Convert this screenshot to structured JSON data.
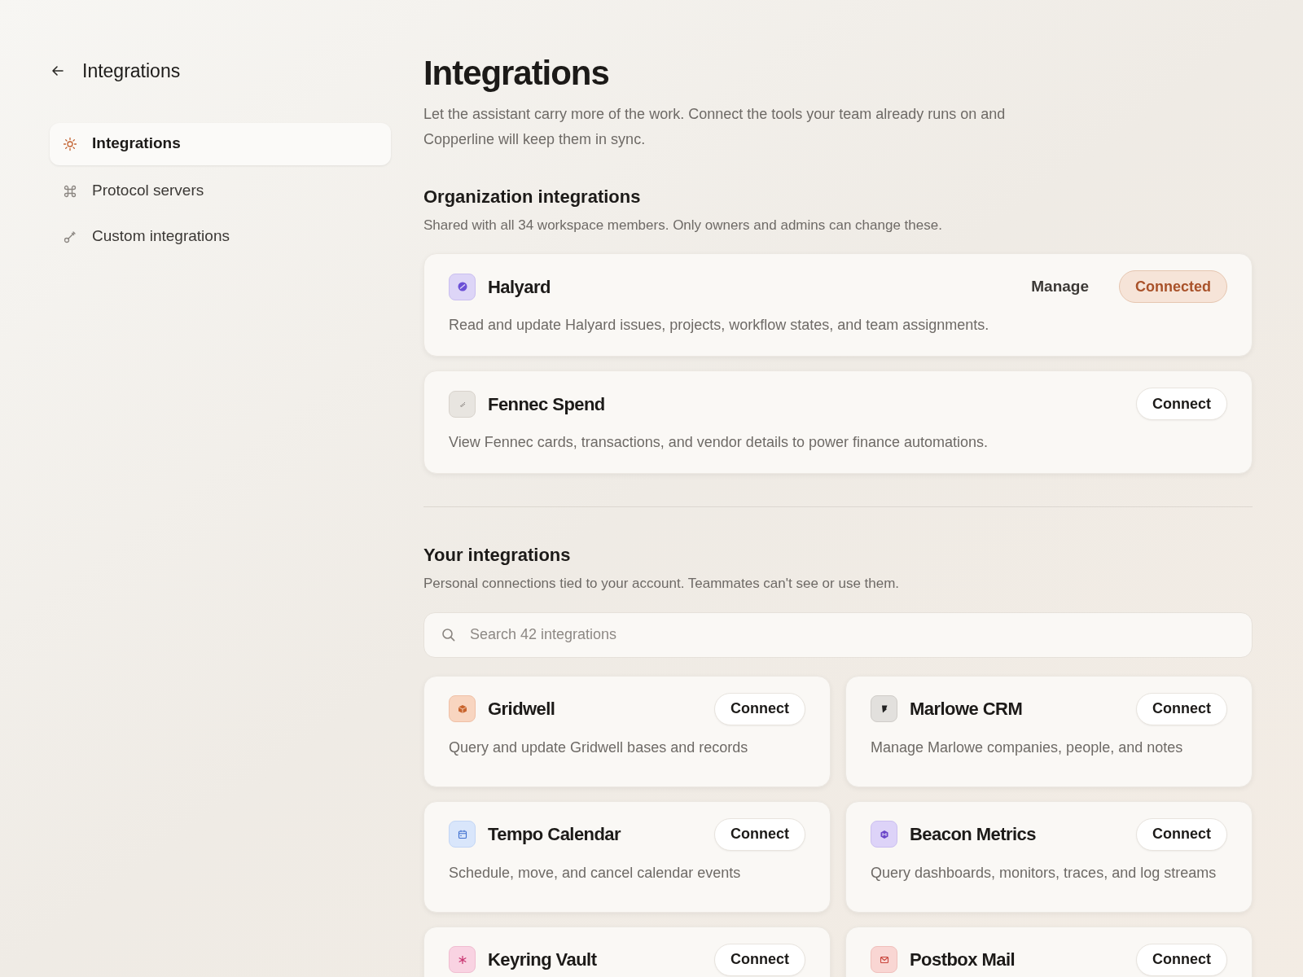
{
  "sidebar": {
    "title": "Integrations",
    "items": [
      {
        "label": "Integrations",
        "selected": true
      },
      {
        "label": "Protocol servers",
        "selected": false
      },
      {
        "label": "Custom integrations",
        "selected": false
      }
    ]
  },
  "page": {
    "title": "Integrations",
    "intro": "Let the assistant carry more of the work. Connect the tools your team already runs on and Copperline will keep them in sync."
  },
  "organization": {
    "heading": "Organization integrations",
    "subtitle": "Shared with all 34 workspace members. Only owners and admins can change these.",
    "items": [
      {
        "name": "Halyard",
        "description": "Read and update Halyard issues, projects, workflow states, and team assignments.",
        "connected": true,
        "manage": "Manage",
        "button": "Connected"
      },
      {
        "name": "Fennec Spend",
        "description": "View Fennec cards, transactions, and vendor details to power finance automations.",
        "connected": false,
        "button": "Connect"
      }
    ]
  },
  "personal": {
    "heading": "Your integrations",
    "subtitle": "Personal connections tied to your account. Teammates can't see or use them.",
    "search": {
      "placeholder": "Search 42 integrations"
    },
    "items": [
      {
        "name": "Gridwell",
        "description": "Query and update Gridwell bases and records",
        "connected": false,
        "button": "Connect"
      },
      {
        "name": "Marlowe CRM",
        "description": "Manage Marlowe companies, people, and notes",
        "connected": false,
        "button": "Connect"
      },
      {
        "name": "Tempo Calendar",
        "description": "Schedule, move, and cancel calendar events",
        "connected": false,
        "button": "Connect"
      },
      {
        "name": "Beacon Metrics",
        "description": "Query dashboards, monitors, traces, and log streams",
        "connected": false,
        "button": "Connect"
      },
      {
        "name": "Keyring Vault",
        "connected": false,
        "button": "Connect"
      },
      {
        "name": "Postbox Mail",
        "connected": false,
        "button": "Connect"
      }
    ]
  }
}
